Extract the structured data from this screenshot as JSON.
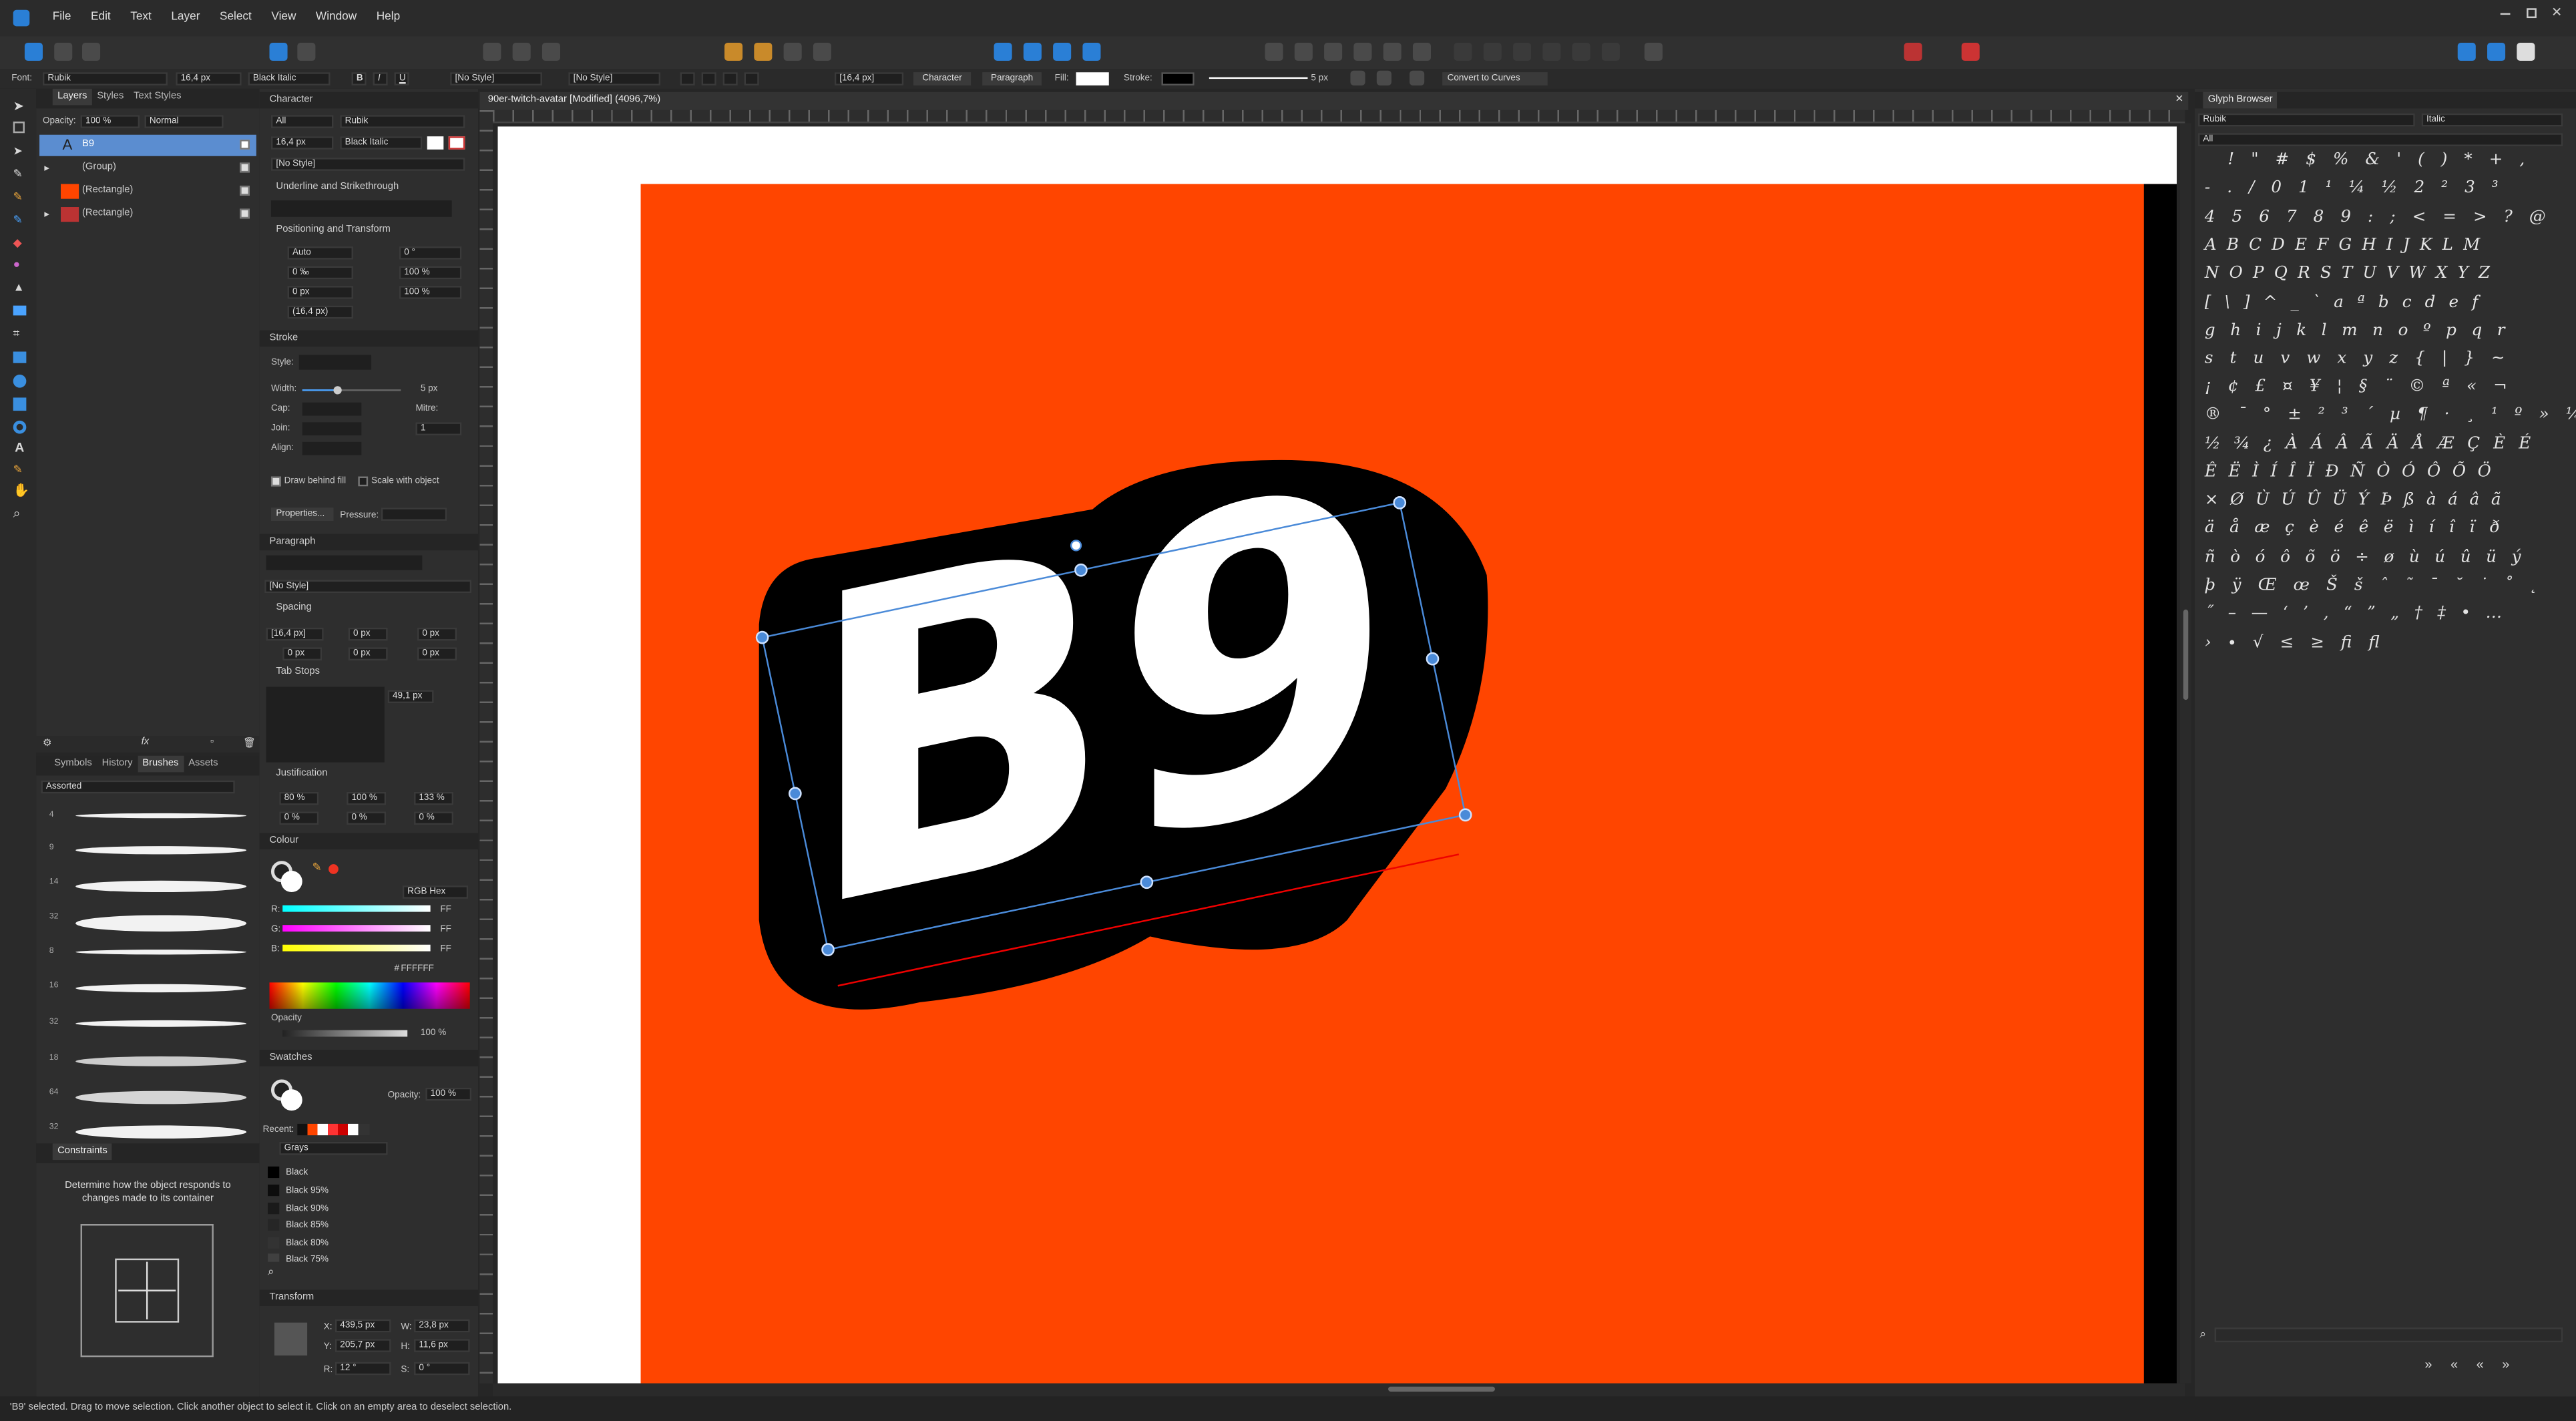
{
  "menu": [
    "File",
    "Edit",
    "Text",
    "Layer",
    "Select",
    "View",
    "Window",
    "Help"
  ],
  "context": {
    "font_label": "Font:",
    "font": "Rubik",
    "size": "16,4 px",
    "style": "Black Italic",
    "char_style": "[No Style]",
    "para_style": "[No Style]",
    "leading": "[16,4 px]",
    "character_btn": "Character",
    "paragraph_btn": "Paragraph",
    "fill_label": "Fill:",
    "stroke_label": "Stroke:",
    "stroke_width": "5 px",
    "convert": "Convert to Curves"
  },
  "doc_tab": "90er-twitch-avatar [Modified] (4096,7%)",
  "layers": {
    "tabs": [
      "Layers",
      "Styles",
      "Text Styles"
    ],
    "opacity_label": "Opacity:",
    "opacity": "100 %",
    "blend": "Normal",
    "items": [
      {
        "name": "B9"
      },
      {
        "name": "(Group)"
      },
      {
        "name": "(Rectangle)"
      },
      {
        "name": "(Rectangle)"
      }
    ]
  },
  "brushes": {
    "tabs": [
      "Symbols",
      "History",
      "Brushes",
      "Assets"
    ],
    "category": "Assorted",
    "sizes": [
      "4",
      "9",
      "14",
      "32",
      "8",
      "16",
      "32",
      "18",
      "64",
      "32"
    ]
  },
  "constraints": {
    "title": "Constraints",
    "text": "Determine how the object responds to changes made to its container"
  },
  "character": {
    "title": "Character",
    "lang": "All",
    "font": "Rubik",
    "size": "16,4 px",
    "style": "Black Italic",
    "no_style": "[No Style]",
    "sec_underline": "Underline and Strikethrough",
    "sec_position": "Positioning and Transform",
    "kern": "Auto",
    "track": "0 ‰",
    "baseline": "0 px",
    "leading": "(16,4 px)",
    "skew": "0 °",
    "hscale": "100 %",
    "vscale": "100 %"
  },
  "stroke": {
    "title": "Stroke",
    "style_label": "Style:",
    "width_label": "Width:",
    "width": "5 px",
    "cap_label": "Cap:",
    "join_label": "Join:",
    "align_label": "Align:",
    "mitre_label": "Mitre:",
    "mitre": "1",
    "behind": "Draw behind fill",
    "scale": "Scale with object",
    "props": "Properties...",
    "pressure": "Pressure:"
  },
  "paragraph": {
    "title": "Paragraph",
    "no_style": "[No Style]",
    "spacing": "Spacing",
    "lead": "[16,4 px]",
    "space_before": "0 px",
    "space_after": "0 px",
    "indent1": "0 px",
    "indent2": "0 px",
    "indent3": "0 px",
    "indent4": "0 px",
    "tab_stops": "Tab Stops",
    "tab_val": "49,1 px",
    "justification": "Justification",
    "j1": "80 %",
    "j2": "100 %",
    "j3": "133 %",
    "j4": "0 %",
    "j5": "0 %",
    "j6": "0 %"
  },
  "colour": {
    "title": "Colour",
    "mode": "RGB Hex",
    "r_label": "R:",
    "g_label": "G:",
    "b_label": "B:",
    "r": "FF",
    "g": "FF",
    "b": "FF",
    "hex": "FFFFFF",
    "opacity_label": "Opacity",
    "opacity": "100 %"
  },
  "swatches": {
    "title": "Swatches",
    "opacity_label": "Opacity:",
    "opacity": "100 %",
    "recent_label": "Recent:",
    "palette": "Grays",
    "items": [
      {
        "name": "Black",
        "color": "#000000"
      },
      {
        "name": "Black 95%",
        "color": "#0d0d0d"
      },
      {
        "name": "Black 90%",
        "color": "#1a1a1a"
      },
      {
        "name": "Black 85%",
        "color": "#262626"
      },
      {
        "name": "Black 80%",
        "color": "#333333"
      },
      {
        "name": "Black 75%",
        "color": "#404040"
      }
    ]
  },
  "transform": {
    "title": "Transform",
    "x_label": "X:",
    "y_label": "Y:",
    "w_label": "W:",
    "h_label": "H:",
    "r_label": "R:",
    "s_label": "S:",
    "x": "439,5 px",
    "y": "205,7 px",
    "w": "23,8 px",
    "h": "11,6 px",
    "r": "12 °",
    "s": "0 °"
  },
  "glyph_browser": {
    "title": "Glyph Browser",
    "font": "Rubik",
    "style": "Italic",
    "set": "All",
    "rows": [
      "! \" # $ % & ' ( ) * + ,",
      "- . / 0 1 ¹ ¼ ½ 2 ² 3 ³",
      "4 5 6 7 8 9 : ; < = > ? @",
      "A B C D E F G H I J K L M",
      "N O P Q R S T U V W X Y Z",
      "[ \\ ] ^ _ ` a ª b c d e f",
      "g h i j k l m n o º p q r",
      "s t u v w x y z { | } ~",
      "¡ ¢ £ ¤ ¥ ¦ § ¨ © ª « ¬",
      "® ¯ ° ± ² ³ ´ µ ¶ · ¸ ¹ º » ¼",
      "½ ¾ ¿ À Á Â Ã Ä Å Æ Ç È É",
      "Ê Ë Ì Í Î Ï Ð Ñ Ò Ó Ô Õ Ö",
      "× Ø Ù Ú Û Ü Ý Þ ß à á â ã",
      "ä å æ ç è é ê ë ì í î ï ð",
      "ñ ò ó ô õ ö ÷ ø ù ú û ü ý",
      "þ ÿ Œ œ Š š ˆ ˜ ˉ ˘ ˙ ˚ ˛",
      "˝ – — ‘ ’ ‚ “ ” „ † ‡ • …",
      "› ∙ √ ≤ ≥ ﬁ ﬂ"
    ],
    "nav": [
      "»",
      "«",
      "«",
      "»"
    ]
  },
  "canvas": {
    "text": "B9",
    "bg": "#ff4500",
    "text_color": "#ffffff",
    "shadow": "#000000"
  },
  "status": "'B9' selected. Drag to move selection. Click another object to select it. Click on an empty area to deselect selection."
}
